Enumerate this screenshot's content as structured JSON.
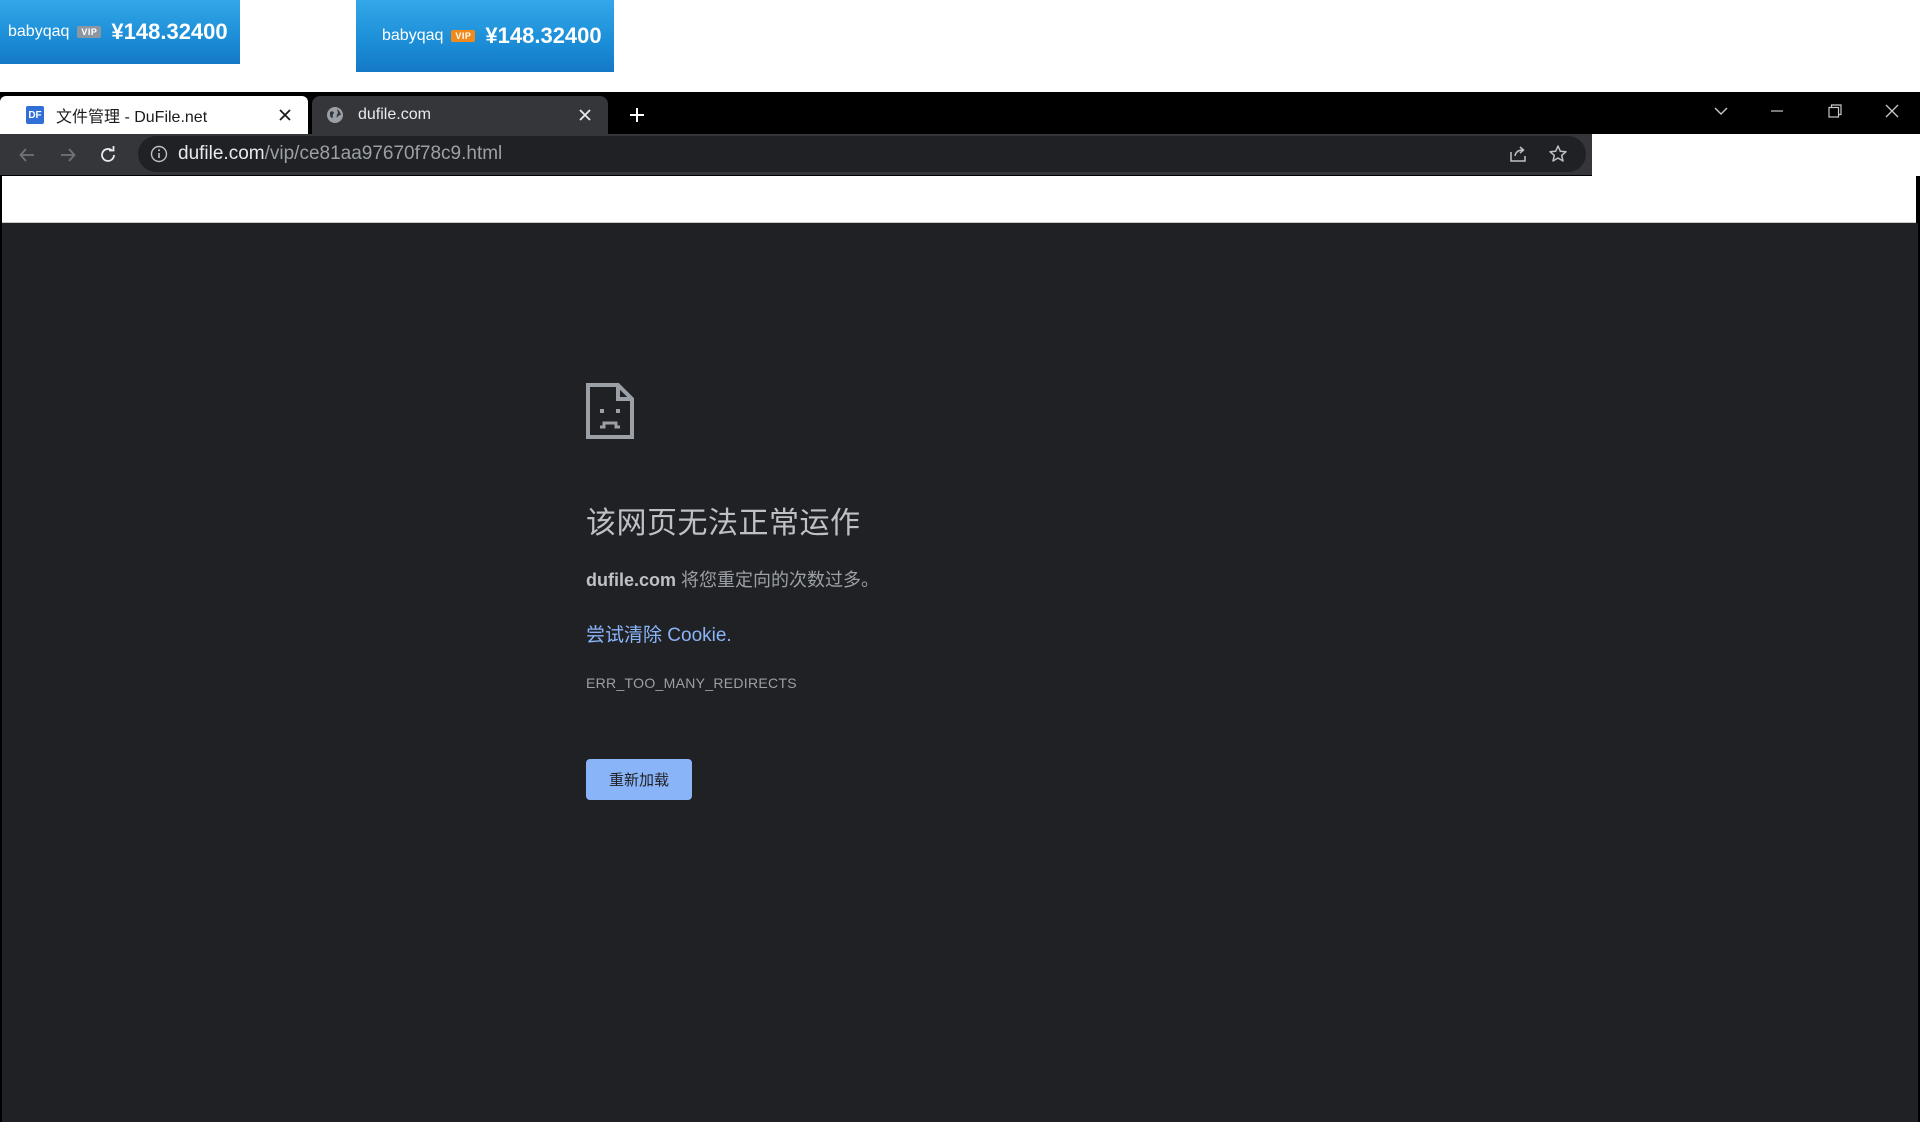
{
  "banners": [
    {
      "user": "babyqaq",
      "vip": "VIP",
      "balance": "¥148.32400"
    },
    {
      "user": "babyqaq",
      "vip": "VIP",
      "balance": "¥148.32400"
    }
  ],
  "browser": {
    "tabs": [
      {
        "favicon": "DF",
        "title": "文件管理 - DuFile.net"
      },
      {
        "favicon": "globe-icon",
        "title": "dufile.com"
      }
    ],
    "omnibox": {
      "host": "dufile.com",
      "path": "/vip/ce81aa97670f78c9.html"
    }
  },
  "error": {
    "heading": "该网页无法正常运作",
    "domain": "dufile.com",
    "description": " 将您重定向的次数过多。",
    "suggestion": "尝试清除 Cookie.",
    "code": "ERR_TOO_MANY_REDIRECTS",
    "reload_label": "重新加载"
  },
  "colors": {
    "page_bg": "#202124",
    "link": "#8ab4f8",
    "button_bg": "#8ab4f8",
    "banner_blue": "#1d8fd8"
  }
}
